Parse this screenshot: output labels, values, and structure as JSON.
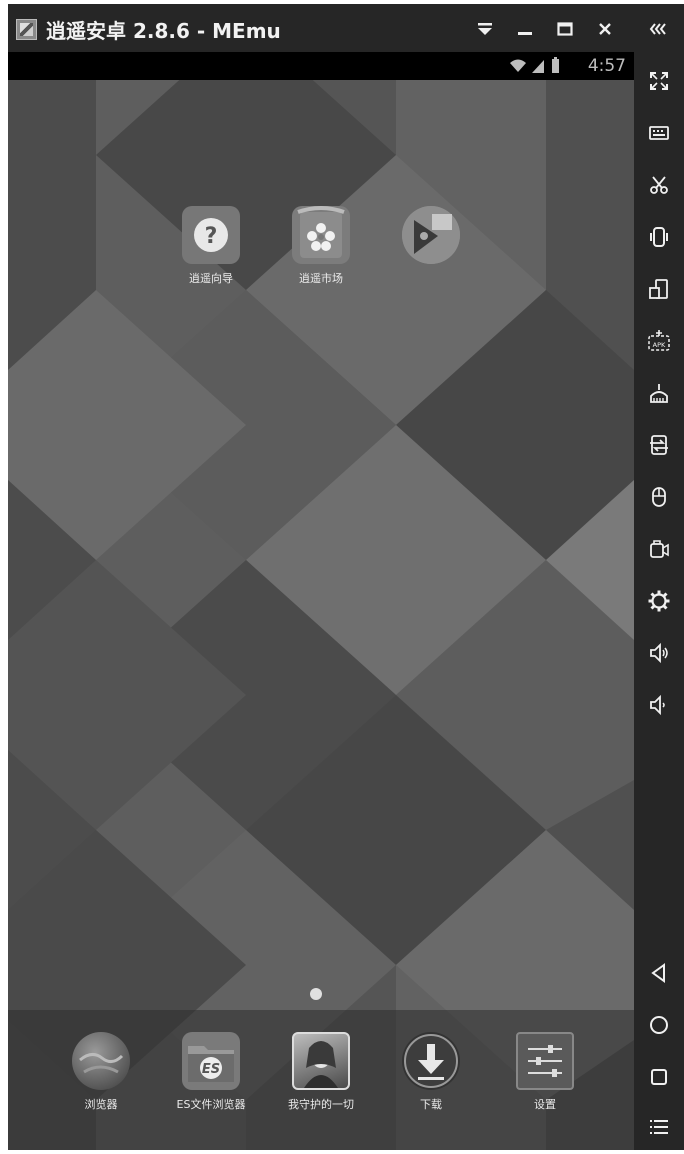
{
  "window": {
    "title": "逍遥安卓 2.8.6 - MEmu"
  },
  "status": {
    "time": "4:57"
  },
  "home_apps": [
    {
      "label": "逍遥向导",
      "icon": "help-question-icon"
    },
    {
      "label": "逍遥市场",
      "icon": "app-market-icon"
    },
    {
      "label": "",
      "icon": "game-center-icon"
    }
  ],
  "dock_apps": [
    {
      "label": "浏览器",
      "icon": "browser-globe-icon"
    },
    {
      "label": "ES文件浏览器",
      "icon": "es-file-explorer-icon"
    },
    {
      "label": "我守护的一切",
      "icon": "game-avatar-icon"
    },
    {
      "label": "下载",
      "icon": "download-icon"
    },
    {
      "label": "设置",
      "icon": "settings-sliders-icon"
    }
  ],
  "titlebar_buttons": [
    "dropdown-icon",
    "minimize-icon",
    "maximize-icon",
    "close-icon"
  ],
  "sidebar_tools": [
    "collapse-sidebar-icon",
    "fullscreen-icon",
    "keyboard-icon",
    "screenshot-scissors-icon",
    "shake-icon",
    "rotate-screen-icon",
    "install-apk-icon",
    "clean-broom-icon",
    "import-export-icon",
    "mouse-icon",
    "video-record-icon",
    "settings-gear-icon",
    "volume-up-icon",
    "volume-down-icon"
  ],
  "nav_buttons": [
    "back-icon",
    "home-icon",
    "recents-icon",
    "menu-icon"
  ],
  "colors": {
    "chrome": "#262626",
    "wallpaper": "#5a5a5a",
    "label": "#eaeaea"
  }
}
